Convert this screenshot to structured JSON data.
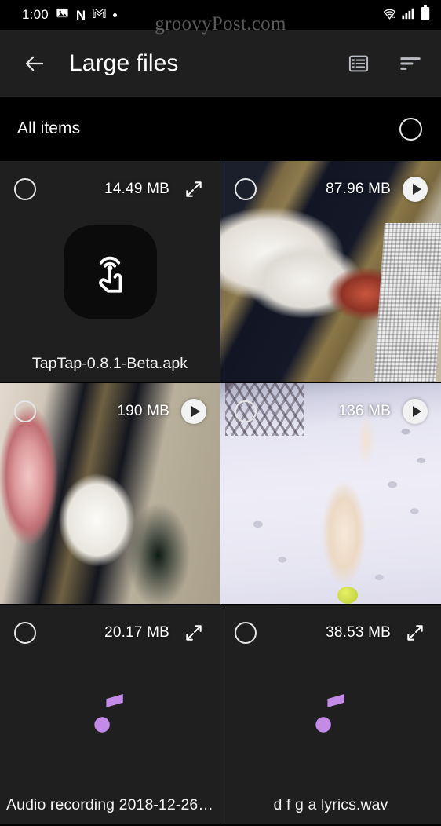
{
  "status_bar": {
    "time": "1:00",
    "left_icons": [
      "image-icon",
      "netflix-icon",
      "gmail-icon",
      "dot-icon"
    ],
    "netflix_letter": "N",
    "right_icons": [
      "wifi-icon",
      "cellular-signal-icon",
      "battery-icon"
    ]
  },
  "watermark": {
    "text": "groovyPost.com"
  },
  "app_bar": {
    "back_icon": "arrow-left-icon",
    "title": "Large files",
    "actions": [
      {
        "icon": "list-view-icon",
        "name": "view-toggle"
      },
      {
        "icon": "sort-icon",
        "name": "sort-button"
      }
    ]
  },
  "filter_row": {
    "label": "All items",
    "select_all_icon": "circle-unchecked-icon"
  },
  "colors": {
    "background": "#000000",
    "app_bar_bg": "#1f1f1f",
    "cell_bg": "#1f1f1f",
    "text_primary": "#ffffff",
    "audio_note": "#c48ae8",
    "watermark": "#8e8e8e"
  },
  "grid": {
    "items": [
      {
        "name": "TapTap-0.8.1-Beta.apk",
        "size": "14.49 MB",
        "kind": "apk",
        "action_icon": "expand-arrows-icon",
        "selected": false
      },
      {
        "name": "",
        "size": "87.96 MB",
        "kind": "video",
        "action_icon": "play-icon",
        "selected": false
      },
      {
        "name": "",
        "size": "190 MB",
        "kind": "video",
        "action_icon": "play-icon",
        "selected": false
      },
      {
        "name": "",
        "size": "136 MB",
        "kind": "video",
        "action_icon": "play-icon",
        "selected": false
      },
      {
        "name": "Audio recording 2018-12-26…",
        "size": "20.17 MB",
        "kind": "audio",
        "action_icon": "expand-arrows-icon",
        "selected": false
      },
      {
        "name": "d f g a lyrics.wav",
        "size": "38.53 MB",
        "kind": "audio",
        "action_icon": "expand-arrows-icon",
        "selected": false
      }
    ]
  }
}
